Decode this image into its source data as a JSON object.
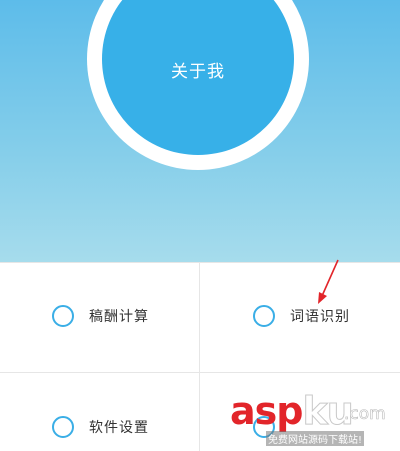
{
  "profile": {
    "label": "关于我"
  },
  "menu": {
    "items": [
      {
        "label": "稿酬计算"
      },
      {
        "label": "词语识别"
      },
      {
        "label": "软件设置"
      },
      {
        "label": ""
      }
    ]
  },
  "watermark": {
    "brand_asp": "asp",
    "brand_ku": "ku",
    "tld": ".com",
    "tagline": "免费网站源码下载站!"
  },
  "colors": {
    "accent": "#37b0e8",
    "header_top": "#5dbcea",
    "header_bottom": "#a6dcec",
    "arrow": "#e2252a",
    "brand_red": "#e2252a"
  }
}
